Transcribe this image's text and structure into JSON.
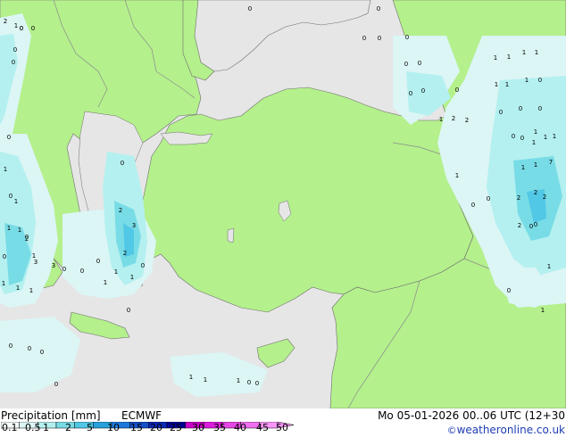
{
  "map": {
    "colors": {
      "sea": "#e6e6e6",
      "land": "#b4f08c",
      "border": "#8c8c8c",
      "coast": "#6e6e6e"
    },
    "precip_values": [
      "0",
      "0",
      "2",
      "0",
      "0",
      "1",
      "0",
      "1",
      "0",
      "1",
      "1",
      "1",
      "0",
      "1",
      "3",
      "3",
      "2",
      "1",
      "1",
      "1",
      "0",
      "2",
      "1",
      "1",
      "1",
      "3",
      "2",
      "0",
      "0",
      "0",
      "0",
      "0",
      "0",
      "0",
      "0",
      "1",
      "1",
      "1",
      "0",
      "0",
      "0",
      "0",
      "0",
      "0",
      "0",
      "0",
      "0",
      "0",
      "0",
      "0",
      "0",
      "0",
      "1",
      "2",
      "2",
      "1",
      "1",
      "1",
      "1",
      "1",
      "1",
      "1",
      "0",
      "0",
      "0",
      "0",
      "0",
      "0",
      "1",
      "1",
      "1",
      "1",
      "1",
      "2",
      "2",
      "0",
      "0",
      "0",
      "1",
      "0",
      "2",
      "7",
      "2",
      "0",
      "1",
      "1",
      "1",
      "0"
    ]
  },
  "footer": {
    "title": "Precipitation [mm]",
    "model": "ECMWF",
    "datetime": "Mo 05-01-2026 00..06 UTC (12+30",
    "credit": "weatheronline.co.uk",
    "credit_symbol": "©"
  },
  "legend": {
    "colors": [
      "#f5fafa",
      "#dcf5f5",
      "#b4f0f0",
      "#78dce6",
      "#50c8e6",
      "#28a0dc",
      "#1e78dc",
      "#1450c8",
      "#0a28b4",
      "#000096",
      "#c800c8",
      "#dc1edc",
      "#e646e6",
      "#f06ef0",
      "#fa96fa"
    ],
    "labels": [
      "0.1",
      "0.5",
      "1",
      "2",
      "5",
      "10",
      "15",
      "20",
      "25",
      "30",
      "35",
      "40",
      "45",
      "50"
    ]
  }
}
